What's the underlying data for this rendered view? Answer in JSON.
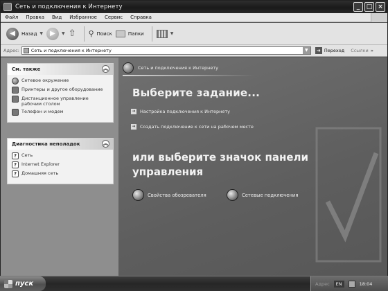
{
  "window": {
    "title": "Сеть и подключения к Интернету"
  },
  "menu": [
    "Файл",
    "Правка",
    "Вид",
    "Избранное",
    "Сервис",
    "Справка"
  ],
  "toolbar": {
    "back_label": "Назад",
    "search_label": "Поиск",
    "folders_label": "Папки"
  },
  "address": {
    "label": "Адрес:",
    "value": "Сеть и подключения к Интернету",
    "go_label": "Переход",
    "links_label": "Ссылки"
  },
  "sidebar": {
    "see_also": {
      "title": "См. также",
      "items": [
        {
          "label": "Сетевое окружение",
          "icon": "network-places-icon"
        },
        {
          "label": "Принтеры и другое оборудование",
          "icon": "printer-icon"
        },
        {
          "label": "Дистанционное управление рабочим столом",
          "icon": "remote-desktop-icon"
        },
        {
          "label": "Телефон и модем",
          "icon": "phone-modem-icon"
        }
      ]
    },
    "troubleshooters": {
      "title": "Диагностика неполадок",
      "items": [
        {
          "label": "Сеть",
          "icon": "help-icon"
        },
        {
          "label": "Internet Explorer",
          "icon": "help-icon"
        },
        {
          "label": "Домашняя сеть",
          "icon": "help-icon"
        }
      ]
    }
  },
  "main": {
    "header_label": "Сеть и подключения к Интернету",
    "pick_task": "Выберите задание...",
    "tasks": [
      "Настройка подключения к Интернету",
      "Создать подключение к сети на рабочем месте"
    ],
    "pick_icon": "или выберите значок панели управления",
    "control_panel_icons": [
      {
        "label": "Свойства обозревателя",
        "icon": "internet-options-icon"
      },
      {
        "label": "Сетевые подключения",
        "icon": "network-connections-icon"
      }
    ]
  },
  "taskbar": {
    "start_label": "пуск",
    "tray_address": "Адрес",
    "language": "EN",
    "clock": "18:04"
  }
}
